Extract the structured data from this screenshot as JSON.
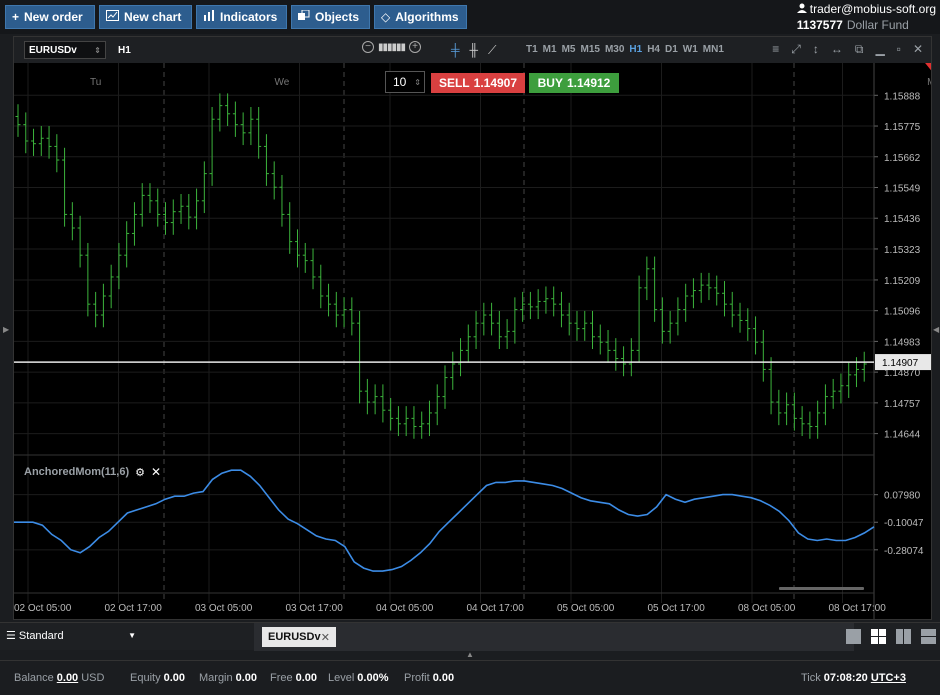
{
  "toolbar": {
    "new_order": "New order",
    "new_chart": "New chart",
    "indicators": "Indicators",
    "objects": "Objects",
    "algorithms": "Algorithms"
  },
  "account": {
    "email": "trader@mobius-soft.org",
    "id": "1137577",
    "fund": "Dollar Fund"
  },
  "chart": {
    "symbol": "EURUSDv",
    "timeframe": "H1",
    "timeframes": [
      "T1",
      "M1",
      "M5",
      "M15",
      "M30",
      "H1",
      "H4",
      "D1",
      "W1",
      "MN1"
    ],
    "active_timeframe": "H1",
    "order_qty": "10",
    "sell_label": "SELL",
    "sell_price": "1.14907",
    "buy_label": "BUY",
    "buy_price": "1.14912",
    "indicator_label": "AnchoredMom(11,6)",
    "current_price": "1.14907",
    "colors": {
      "up": "#3cb43c",
      "line": "#3c8ce6",
      "sell": "#d94040",
      "buy": "#3d9e3d"
    }
  },
  "chart_data": [
    {
      "type": "bar",
      "series_kind": "ohlc",
      "day_labels": [
        {
          "label": "Tu",
          "x_index": 10
        },
        {
          "label": "We",
          "x_index": 34
        },
        {
          "label": "Mo",
          "x_index": 118
        }
      ],
      "y_ticks": [
        "1.15888",
        "1.15775",
        "1.15662",
        "1.15549",
        "1.15436",
        "1.15323",
        "1.15209",
        "1.15096",
        "1.14983",
        "1.14870",
        "1.14757",
        "1.14644"
      ],
      "ylim": [
        1.1458,
        1.1597
      ],
      "current_price": 1.14907,
      "x_labels": [
        "02 Oct 05:00",
        "02 Oct 17:00",
        "03 Oct 05:00",
        "03 Oct 17:00",
        "04 Oct 05:00",
        "04 Oct 17:00",
        "05 Oct 05:00",
        "05 Oct 17:00",
        "08 Oct 05:00",
        "08 Oct 17:00"
      ],
      "closes": [
        1.1578,
        1.1572,
        1.1571,
        1.1573,
        1.157,
        1.1565,
        1.1545,
        1.154,
        1.153,
        1.1512,
        1.1508,
        1.1515,
        1.1522,
        1.153,
        1.1538,
        1.1545,
        1.1552,
        1.155,
        1.1545,
        1.1542,
        1.1546,
        1.1548,
        1.1544,
        1.155,
        1.156,
        1.158,
        1.1585,
        1.1582,
        1.1578,
        1.1575,
        1.158,
        1.157,
        1.156,
        1.1555,
        1.1545,
        1.1535,
        1.153,
        1.1528,
        1.1522,
        1.1515,
        1.1512,
        1.1508,
        1.151,
        1.1505,
        1.148,
        1.1476,
        1.1478,
        1.1473,
        1.147,
        1.1468,
        1.147,
        1.1467,
        1.1468,
        1.1472,
        1.1478,
        1.1485,
        1.149,
        1.1495,
        1.15,
        1.1505,
        1.1508,
        1.1505,
        1.15,
        1.1502,
        1.151,
        1.1512,
        1.1511,
        1.1513,
        1.1514,
        1.1512,
        1.1508,
        1.1505,
        1.1503,
        1.1505,
        1.15,
        1.1498,
        1.1495,
        1.1492,
        1.149,
        1.1495,
        1.1518,
        1.1525,
        1.151,
        1.1502,
        1.1505,
        1.151,
        1.1515,
        1.1517,
        1.1519,
        1.1518,
        1.1516,
        1.1512,
        1.1508,
        1.1506,
        1.1503,
        1.1498,
        1.1488,
        1.1476,
        1.1472,
        1.1475,
        1.147,
        1.1468,
        1.1467,
        1.1472,
        1.1478,
        1.148,
        1.1482,
        1.1486,
        1.1488,
        1.149
      ]
    },
    {
      "type": "line",
      "title": "AnchoredMom(11,6)",
      "y_ticks": [
        "0.07980",
        "-0.10047",
        "-0.28074"
      ],
      "ylim": [
        -0.55,
        0.3
      ],
      "values": [
        -0.1,
        -0.1,
        -0.1,
        -0.12,
        -0.18,
        -0.22,
        -0.28,
        -0.3,
        -0.26,
        -0.2,
        -0.16,
        -0.1,
        -0.04,
        -0.02,
        0.0,
        0.02,
        0.05,
        0.07,
        0.07,
        0.09,
        0.1,
        0.18,
        0.22,
        0.24,
        0.24,
        0.2,
        0.14,
        0.06,
        -0.02,
        -0.08,
        -0.11,
        -0.15,
        -0.19,
        -0.21,
        -0.22,
        -0.26,
        -0.36,
        -0.4,
        -0.42,
        -0.42,
        -0.41,
        -0.39,
        -0.35,
        -0.3,
        -0.24,
        -0.16,
        -0.1,
        -0.04,
        0.02,
        0.08,
        0.14,
        0.16,
        0.16,
        0.17,
        0.17,
        0.16,
        0.15,
        0.14,
        0.12,
        0.09,
        0.06,
        0.04,
        0.03,
        0.02,
        -0.02,
        -0.05,
        -0.06,
        -0.05,
        0.0,
        0.08,
        0.05,
        0.03,
        0.05,
        0.06,
        0.07,
        0.08,
        0.08,
        0.07,
        0.06,
        0.04,
        0.01,
        -0.03,
        -0.09,
        -0.17,
        -0.21,
        -0.22,
        -0.21,
        -0.22,
        -0.22,
        -0.2,
        -0.17,
        -0.13
      ]
    }
  ],
  "workspace": {
    "name": "Standard",
    "tab_label": "EURUSDv"
  },
  "status": {
    "balance_label": "Balance",
    "balance_value": "0.00",
    "currency": "USD",
    "equity_label": "Equity",
    "equity_value": "0.00",
    "margin_label": "Margin",
    "margin_value": "0.00",
    "free_label": "Free",
    "free_value": "0.00",
    "level_label": "Level",
    "level_value": "0.00%",
    "profit_label": "Profit",
    "profit_value": "0.00",
    "tick_label": "Tick",
    "tick_value": "07:08:20",
    "timezone": "UTC+3"
  }
}
